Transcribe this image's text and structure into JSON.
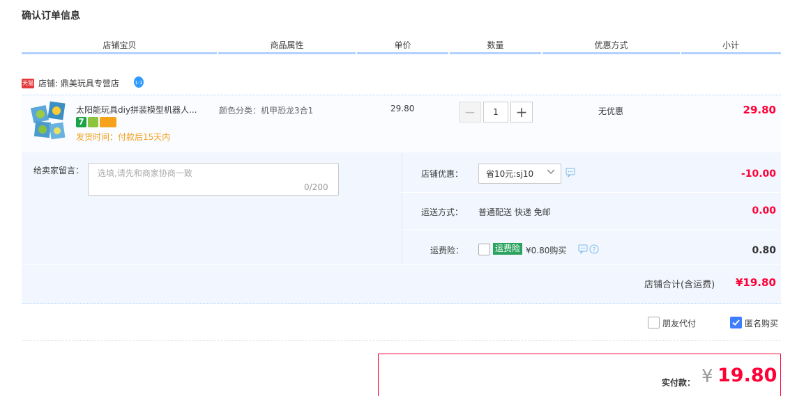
{
  "page_title": "确认订单信息",
  "table_headers": [
    "店铺宝贝",
    "商品属性",
    "单价",
    "数量",
    "优惠方式",
    "小计"
  ],
  "shop": {
    "badge": "天猫",
    "label": "店铺: 鼎美玩具专营店"
  },
  "item": {
    "title": "太阳能玩具diy拼装模型机器人...",
    "ship_time": "发货时间：付款后15天内",
    "sku": "颜色分类：机甲恐龙3合1",
    "unit_price": "29.80",
    "quantity": "1",
    "minus_label": "−",
    "plus_label": "+",
    "discount": "无优惠",
    "subtotal": "29.80",
    "service_icons": [
      "seven-day-return-icon",
      "shop-guarantee-icon",
      "card-payment-icon"
    ]
  },
  "message": {
    "label": "给卖家留言：",
    "placeholder": "选填,请先和商家协商一致",
    "count": "0/200"
  },
  "shop_coupon": {
    "label": "店铺优惠：",
    "selected": "省10元:sj10",
    "value": "-10.00"
  },
  "shipping": {
    "label": "运送方式：",
    "text": "普通配送 快递 免邮",
    "value": "0.00"
  },
  "insurance": {
    "label": "运费险：",
    "tag": "运费险",
    "text": "¥0.80购买",
    "value": "0.80"
  },
  "shop_total": {
    "label": "店铺合计(含运费)",
    "value": "¥19.80"
  },
  "options": {
    "friend_pay": "朋友代付",
    "anonymous": "匿名购买",
    "anonymous_checked": true,
    "friend_pay_checked": false
  },
  "payment": {
    "label": "实付款：",
    "currency": "¥",
    "value": "19.80"
  },
  "colors": {
    "accent_red": "#ff0036",
    "header_line": "#b2d1ff",
    "panel_bg": "#f2f7ff",
    "checkbox_blue": "#3d7eff",
    "ship_time": "#f0a020",
    "insure_green": "#2aa35e"
  }
}
